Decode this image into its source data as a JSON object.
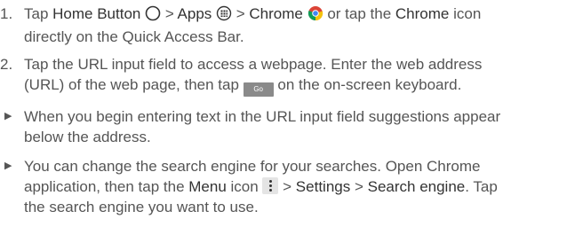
{
  "steps": [
    {
      "number": "1.",
      "t1": "Tap ",
      "home": "Home Button",
      "t2": " > ",
      "apps": "Apps",
      "t3": " > ",
      "chrome": "Chrome",
      "t4": " or tap the ",
      "chrome2": "Chrome",
      "t5": " icon",
      "line2": "directly on the Quick Access Bar."
    },
    {
      "number": "2.",
      "line1": "Tap the URL input field to access a webpage. Enter the web address",
      "t1": "(URL) of the web page, then tap ",
      "go_label": "Go",
      "t2": " on the on-screen keyboard."
    }
  ],
  "notes": [
    {
      "line1": "When you begin entering text in the URL input field suggestions appear",
      "line2": "below the address."
    },
    {
      "line1": "You can change the search engine for your searches. Open Chrome",
      "t1": "application, then tap the ",
      "menu": "Menu",
      "t2": " icon ",
      "t3": " > ",
      "settings": "Settings",
      "t4": " > ",
      "search_engine": "Search engine",
      "t5": ". Tap",
      "line3": "the search engine you want to use."
    }
  ],
  "icons": {
    "home": "home-button-icon",
    "apps": "apps-grid-icon",
    "chrome": "chrome-logo-icon",
    "menu": "menu-dots-icon",
    "bullet": "triangle-bullet-icon"
  },
  "colors": {
    "text": "#555555",
    "emphasis": "#333333",
    "go_key": "#8a8a8a",
    "menu_key": "#e4e4e4"
  }
}
